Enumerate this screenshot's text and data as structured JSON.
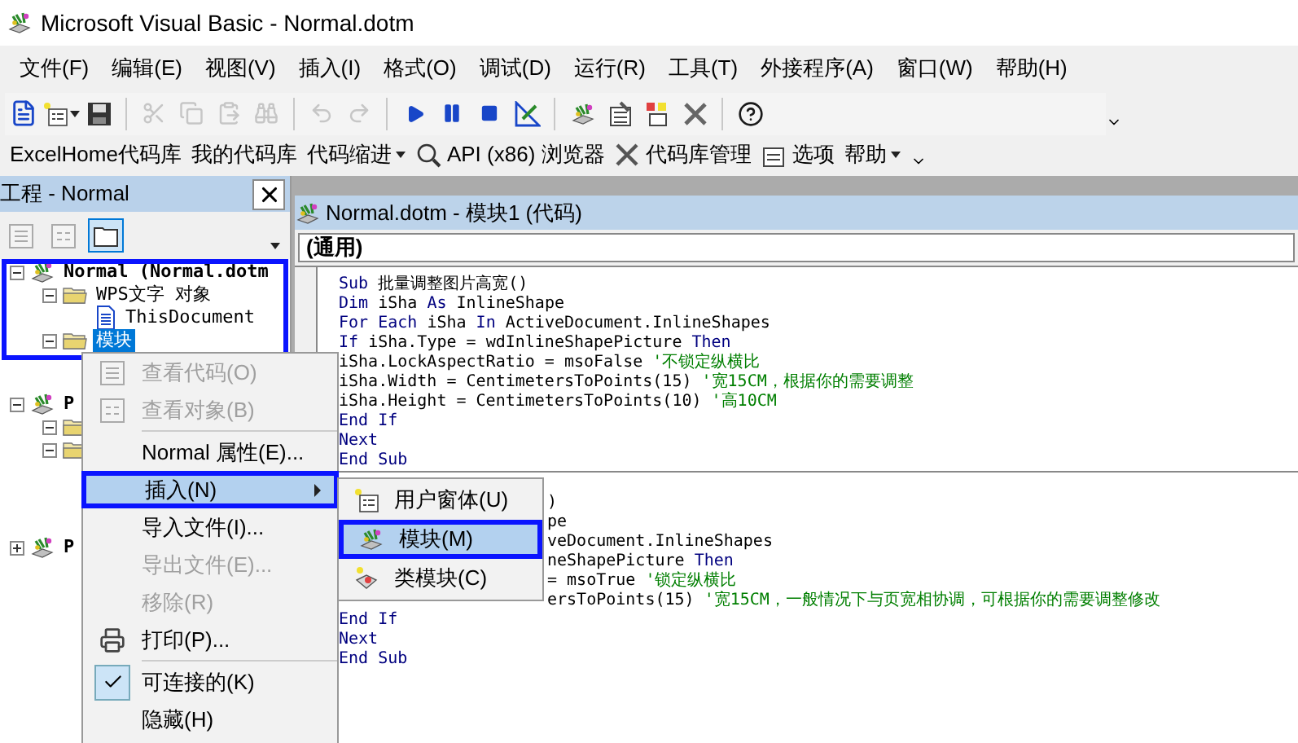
{
  "window": {
    "title": "Microsoft Visual Basic - Normal.dotm"
  },
  "menu_bar": [
    "文件(F)",
    "编辑(E)",
    "视图(V)",
    "插入(I)",
    "格式(O)",
    "调试(D)",
    "运行(R)",
    "工具(T)",
    "外接程序(A)",
    "窗口(W)",
    "帮助(H)"
  ],
  "toolbar": [
    {
      "kind": "new-doc",
      "disabled": false
    },
    {
      "kind": "userform",
      "disabled": false
    },
    {
      "kind": "save",
      "disabled": false
    },
    {
      "kind": "sep"
    },
    {
      "kind": "cut",
      "disabled": true
    },
    {
      "kind": "copy",
      "disabled": true
    },
    {
      "kind": "paste",
      "disabled": true
    },
    {
      "kind": "find",
      "disabled": true
    },
    {
      "kind": "sep"
    },
    {
      "kind": "undo",
      "disabled": true
    },
    {
      "kind": "redo",
      "disabled": true
    },
    {
      "kind": "sep"
    },
    {
      "kind": "run",
      "disabled": false
    },
    {
      "kind": "pause",
      "disabled": false
    },
    {
      "kind": "stop",
      "disabled": false
    },
    {
      "kind": "design",
      "disabled": false
    },
    {
      "kind": "sep"
    },
    {
      "kind": "project",
      "disabled": false
    },
    {
      "kind": "properties",
      "disabled": false
    },
    {
      "kind": "browser",
      "disabled": false
    },
    {
      "kind": "toolbox",
      "disabled": false
    },
    {
      "kind": "sep"
    },
    {
      "kind": "help",
      "disabled": false
    }
  ],
  "addin_toolbar": [
    {
      "kind": "text",
      "label": "ExcelHome代码库"
    },
    {
      "kind": "text",
      "label": "我的代码库"
    },
    {
      "kind": "dropdown",
      "label": "代码缩进"
    },
    {
      "kind": "api",
      "label": "API (x86) 浏览器"
    },
    {
      "kind": "tools",
      "label": "代码库管理"
    },
    {
      "kind": "options",
      "label": "选项"
    },
    {
      "kind": "dropdown",
      "label": "帮助"
    }
  ],
  "project_pane": {
    "title": "工程 - Normal",
    "view_buttons": [
      {
        "kind": "code",
        "selected": false
      },
      {
        "kind": "object",
        "selected": false
      },
      {
        "kind": "folders",
        "selected": true
      }
    ],
    "tree": [
      {
        "kind": "project",
        "label": "Normal (Normal.dotm",
        "expanded": true,
        "selected": false,
        "children": [
          {
            "kind": "folder",
            "label": "WPS文字 对象",
            "expanded": true,
            "selected": false,
            "children": [
              {
                "kind": "document",
                "label": "ThisDocument",
                "selected": false
              }
            ]
          },
          {
            "kind": "folder",
            "label": "模块",
            "expanded": true,
            "selected": true
          }
        ]
      },
      {
        "kind": "project",
        "label": "P",
        "expanded": true,
        "selected": false,
        "children": [
          {
            "kind": "folder",
            "expanded": true
          },
          {
            "kind": "folder",
            "expanded": true
          }
        ]
      },
      {
        "kind": "project",
        "label": "P",
        "expanded": false,
        "selected": false
      }
    ]
  },
  "code_window": {
    "title": "Normal.dotm - 模块1 (代码)",
    "object_combo": "(通用)",
    "procedures": [
      {
        "lines": [
          {
            "parts": [
              {
                "kind": "keyword",
                "text": "Sub"
              },
              {
                "kind": "plain",
                "text": " 批量调整图片高宽()"
              }
            ]
          },
          {
            "parts": [
              {
                "kind": "keyword",
                "text": "Dim"
              },
              {
                "kind": "plain",
                "text": " iSha "
              },
              {
                "kind": "keyword",
                "text": "As"
              },
              {
                "kind": "plain",
                "text": " InlineShape"
              }
            ]
          },
          {
            "parts": [
              {
                "kind": "keyword",
                "text": "For Each"
              },
              {
                "kind": "plain",
                "text": " iSha "
              },
              {
                "kind": "keyword",
                "text": "In"
              },
              {
                "kind": "plain",
                "text": " ActiveDocument.InlineShapes"
              }
            ]
          },
          {
            "parts": [
              {
                "kind": "keyword",
                "text": "If"
              },
              {
                "kind": "plain",
                "text": " iSha.Type = wdInlineShapePicture "
              },
              {
                "kind": "keyword",
                "text": "Then"
              }
            ]
          },
          {
            "parts": [
              {
                "kind": "plain",
                "text": "iSha.LockAspectRatio = msoFalse "
              },
              {
                "kind": "comment",
                "text": "'不锁定纵横比"
              }
            ]
          },
          {
            "parts": [
              {
                "kind": "plain",
                "text": "iSha.Width = CentimetersToPoints(15) "
              },
              {
                "kind": "comment",
                "text": "'宽15CM，根据你的需要调整"
              }
            ]
          },
          {
            "parts": [
              {
                "kind": "plain",
                "text": "iSha.Height = CentimetersToPoints(10) "
              },
              {
                "kind": "comment",
                "text": "'高10CM"
              }
            ]
          },
          {
            "parts": [
              {
                "kind": "keyword",
                "text": "End If"
              }
            ]
          },
          {
            "parts": [
              {
                "kind": "keyword",
                "text": "Next"
              }
            ]
          },
          {
            "parts": [
              {
                "kind": "keyword",
                "text": "End Sub"
              }
            ]
          }
        ]
      },
      {
        "clipped_lines": [
          {
            "parts": [
              {
                "kind": "plain",
                "text": ")"
              }
            ]
          },
          {
            "parts": [
              {
                "kind": "plain",
                "text": "pe"
              }
            ]
          },
          {
            "parts": [
              {
                "kind": "plain",
                "text": "veDocument.InlineShapes"
              }
            ]
          },
          {
            "parts": [
              {
                "kind": "plain",
                "text": "neShapePicture "
              },
              {
                "kind": "keyword",
                "text": "Then"
              }
            ]
          },
          {
            "parts": [
              {
                "kind": "plain",
                "text": "= msoTrue "
              },
              {
                "kind": "comment",
                "text": "'锁定纵横比"
              }
            ]
          },
          {
            "parts": [
              {
                "kind": "plain",
                "text": "ersToPoints(15) "
              },
              {
                "kind": "comment",
                "text": "'宽15CM，一般情况下与页宽相协调，可根据你的需要调整修改"
              }
            ]
          }
        ],
        "lines": [
          {
            "parts": [
              {
                "kind": "keyword",
                "text": "End If"
              }
            ]
          },
          {
            "parts": [
              {
                "kind": "keyword",
                "text": "Next"
              }
            ]
          },
          {
            "parts": [
              {
                "kind": "keyword",
                "text": "End Sub"
              }
            ]
          }
        ]
      }
    ]
  },
  "context_menu": [
    {
      "kind": "item",
      "label": "查看代码(O)",
      "disabled": true,
      "selected": false
    },
    {
      "kind": "item",
      "label": "查看对象(B)",
      "disabled": true,
      "selected": false
    },
    {
      "kind": "separator"
    },
    {
      "kind": "item",
      "label": "Normal 属性(E)...",
      "disabled": false,
      "selected": false
    },
    {
      "kind": "submenu",
      "label": "插入(N)",
      "disabled": false,
      "selected": true
    },
    {
      "kind": "item",
      "label": "导入文件(I)...",
      "disabled": false,
      "selected": false
    },
    {
      "kind": "item",
      "label": "导出文件(E)...",
      "disabled": true,
      "selected": false
    },
    {
      "kind": "item",
      "label": "移除(R)",
      "disabled": true,
      "selected": false
    },
    {
      "kind": "item",
      "label": "打印(P)...",
      "disabled": false,
      "selected": false
    },
    {
      "kind": "separator"
    },
    {
      "kind": "check",
      "label": "可连接的(K)",
      "checked": true,
      "disabled": false,
      "selected": false
    },
    {
      "kind": "item",
      "label": "隐藏(H)",
      "disabled": false,
      "selected": false
    }
  ],
  "insert_submenu": [
    {
      "label": "用户窗体(U)",
      "selected": false
    },
    {
      "label": "模块(M)",
      "selected": true
    },
    {
      "label": "类模块(C)",
      "selected": false
    }
  ]
}
